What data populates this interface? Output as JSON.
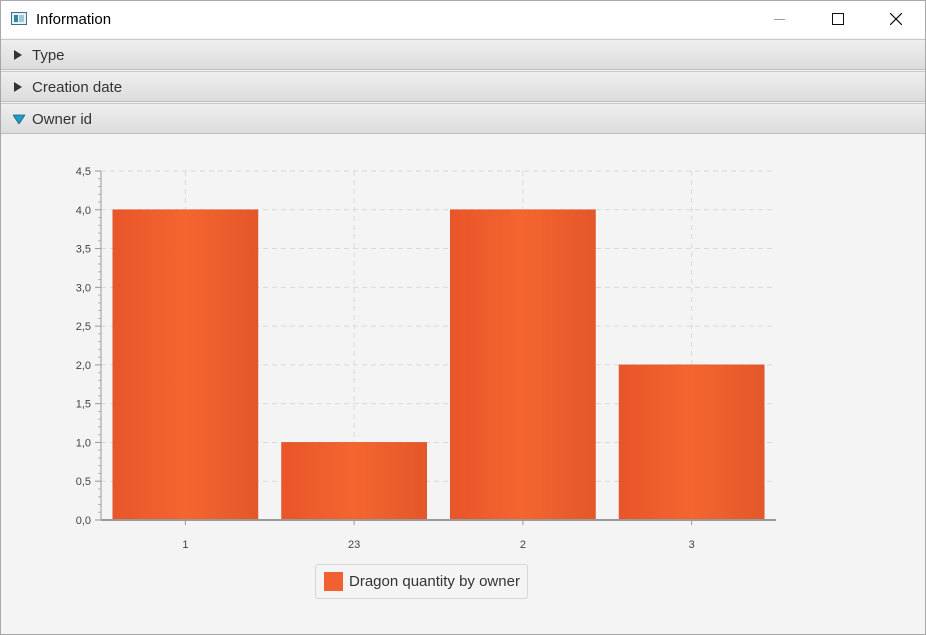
{
  "window": {
    "title": "Information",
    "icon": "app-window-icon",
    "controls": [
      "minimize-icon",
      "maximize-icon",
      "close-icon"
    ]
  },
  "panes": [
    {
      "label": "Type",
      "expanded": false
    },
    {
      "label": "Creation date",
      "expanded": false
    },
    {
      "label": "Owner id",
      "expanded": true
    }
  ],
  "colors": {
    "bar": "#f06030",
    "expanded_arrow": "#1d9dc7"
  },
  "chart_data": {
    "type": "bar",
    "categories": [
      "1",
      "23",
      "2",
      "3"
    ],
    "series": [
      {
        "name": "Dragon quantity by owner",
        "values": [
          4,
          1,
          4,
          2
        ]
      }
    ],
    "ylim": [
      0,
      4.5
    ],
    "yticks": [
      "0,0",
      "0,5",
      "1,0",
      "1,5",
      "2,0",
      "2,5",
      "3,0",
      "3,5",
      "4,0",
      "4,5"
    ],
    "grid": true,
    "legend_position": "bottom"
  }
}
